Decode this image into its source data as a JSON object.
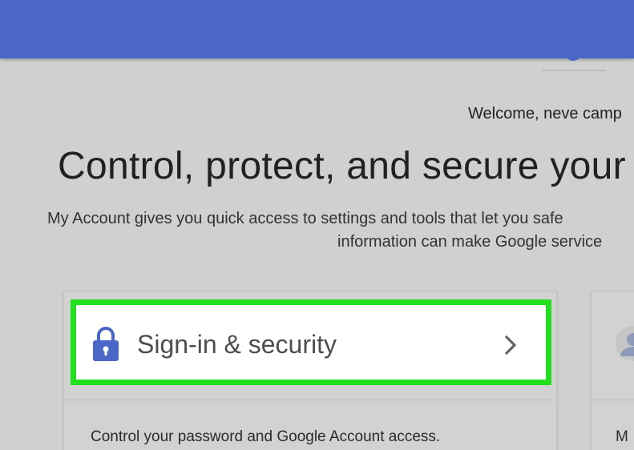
{
  "header": {
    "welcome_text": "Welcome, neve camp"
  },
  "main": {
    "headline": "Control, protect, and secure your",
    "intro_line1": "My Account gives you quick access to settings and tools that let you safe",
    "intro_line2": "information can make Google service"
  },
  "cards": [
    {
      "title": "Sign-in & security",
      "description": "Control your password and Google Account access.",
      "icon": "lock-icon",
      "action_icon": "chevron-right-icon",
      "highlighted": true
    },
    {
      "title": "",
      "description": "M",
      "icon": "person-icon"
    }
  ],
  "colors": {
    "top_bar": "#4a67c7",
    "highlight_border": "#22e01e",
    "icon_blue": "#4a67c7"
  }
}
